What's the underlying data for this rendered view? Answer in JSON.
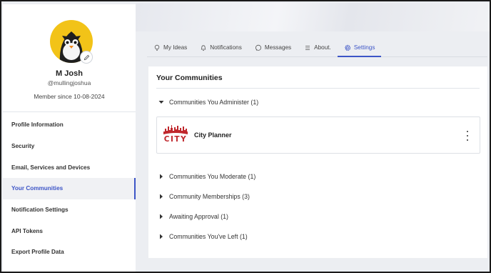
{
  "profile": {
    "name": "M Josh",
    "handle": "@mullingjoshua",
    "member_since": "Member since 10-08-2024"
  },
  "sidebar": {
    "items": [
      {
        "label": "Profile Information",
        "active": false
      },
      {
        "label": "Security",
        "active": false
      },
      {
        "label": "Email, Services and Devices",
        "active": false
      },
      {
        "label": "Your Communities",
        "active": true
      },
      {
        "label": "Notification Settings",
        "active": false
      },
      {
        "label": "API Tokens",
        "active": false
      },
      {
        "label": "Export Profile Data",
        "active": false
      }
    ]
  },
  "tabs": [
    {
      "label": "My Ideas",
      "icon": "lightbulb-icon",
      "active": false
    },
    {
      "label": "Notifications",
      "icon": "bell-icon",
      "active": false
    },
    {
      "label": "Messages",
      "icon": "chat-bubble-icon",
      "active": false
    },
    {
      "label": "About.",
      "icon": "menu-lines-icon",
      "active": false
    },
    {
      "label": "Settings",
      "icon": "gear-icon",
      "active": true
    }
  ],
  "main": {
    "title": "Your Communities",
    "sections": [
      {
        "label": "Communities You Administer (1)",
        "expanded": true
      },
      {
        "label": "Communities You Moderate (1)",
        "expanded": false
      },
      {
        "label": "Community Memberships (3)",
        "expanded": false
      },
      {
        "label": "Awaiting Approval (1)",
        "expanded": false
      },
      {
        "label": "Communities You've Left (1)",
        "expanded": false
      }
    ],
    "administered": [
      {
        "name": "City Planner",
        "logo_text": "CITY"
      }
    ]
  },
  "colors": {
    "accent": "#3d55c7",
    "avatar_bg": "#f2c318",
    "city_logo": "#c0282d"
  }
}
